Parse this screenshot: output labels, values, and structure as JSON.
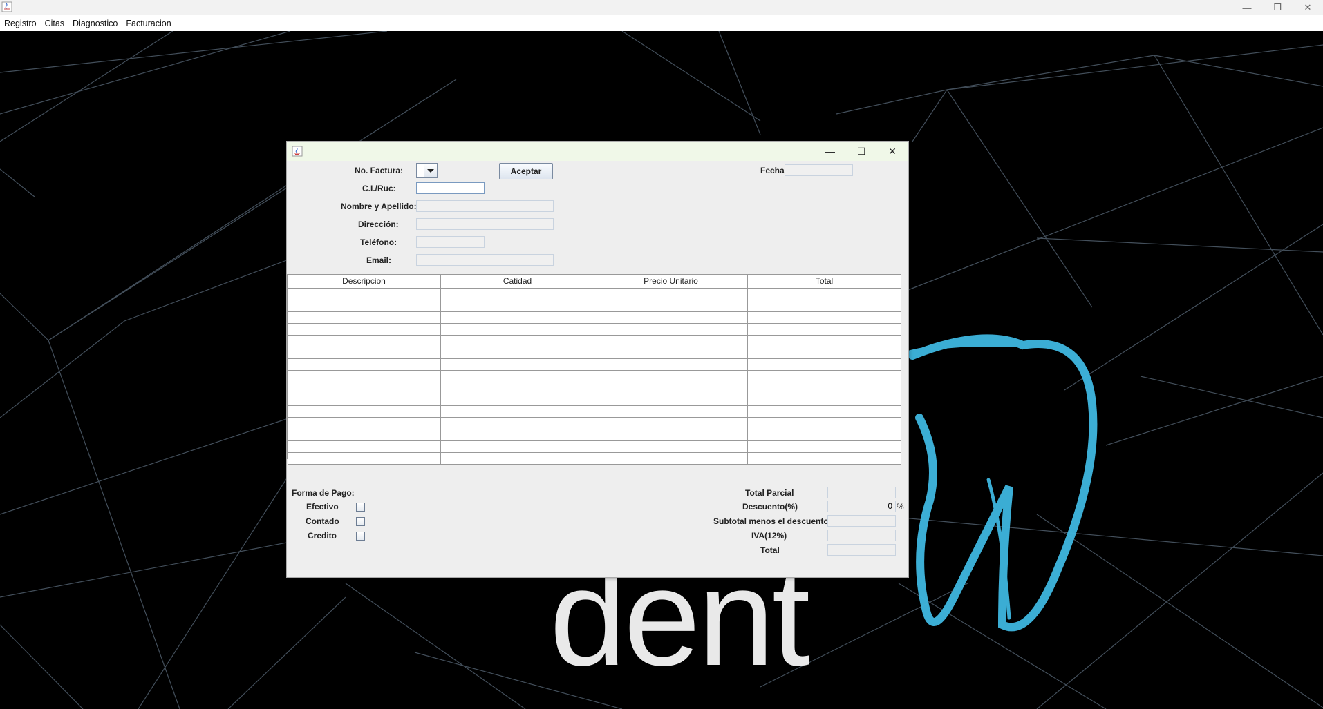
{
  "menu": [
    "Registro",
    "Citas",
    "Diagnostico",
    "Facturacion"
  ],
  "brand_text": "dent",
  "form": {
    "no_factura_label": "No. Factura:",
    "aceptar_label": "Aceptar",
    "fecha_label": "Fecha",
    "ci_ruc_label": "C.I./Ruc:",
    "nombre_label": "Nombre y Apellido:",
    "direccion_label": "Dirección:",
    "telefono_label": "Teléfono:",
    "email_label": "Email:"
  },
  "table": {
    "columns": [
      "Descripcion",
      "Catidad",
      "Precio Unitario",
      "Total"
    ],
    "row_count": 15
  },
  "payment": {
    "title": "Forma de Pago:",
    "options": [
      "Efectivo",
      "Contado",
      "Credito"
    ]
  },
  "summary": {
    "total_parcial": "Total Parcial",
    "descuento": "Descuento(%)",
    "descuento_value": "0",
    "descuento_unit": "%",
    "subtotal": "Subtotal menos el descuento",
    "iva": "IVA(12%)",
    "total": "Total"
  },
  "colors": {
    "tooth_glow": "#3fb7e0",
    "desktop_bg": "#000000",
    "frame_title_bg": "#f0f8e8"
  }
}
